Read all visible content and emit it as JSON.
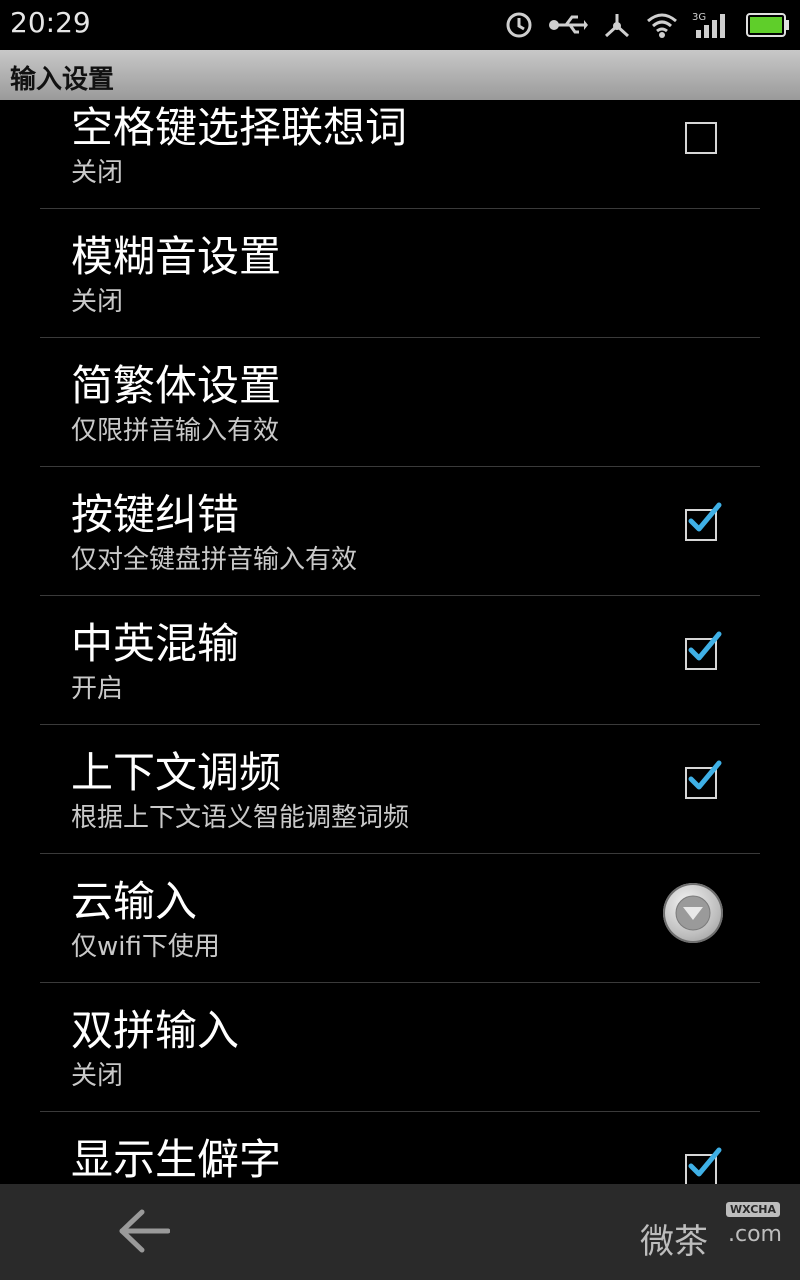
{
  "status_bar": {
    "time": "20:29",
    "icons": [
      "sync-icon",
      "usb-icon",
      "usb-debug-icon",
      "wifi-icon",
      "signal-3g-icon",
      "battery-icon"
    ],
    "network_label": "3G",
    "accent_color": "#5fce2a"
  },
  "title_bar": {
    "title": "输入设置"
  },
  "settings": [
    {
      "title": "空格键选择联想词",
      "summary": "关闭",
      "control": "checkbox",
      "checked": false
    },
    {
      "title": "模糊音设置",
      "summary": "关闭",
      "control": "none"
    },
    {
      "title": "简繁体设置",
      "summary": "仅限拼音输入有效",
      "control": "none"
    },
    {
      "title": "按键纠错",
      "summary": "仅对全键盘拼音输入有效",
      "control": "checkbox",
      "checked": true
    },
    {
      "title": "中英混输",
      "summary": "开启",
      "control": "checkbox",
      "checked": true
    },
    {
      "title": "上下文调频",
      "summary": "根据上下文语义智能调整词频",
      "control": "checkbox",
      "checked": true
    },
    {
      "title": "云输入",
      "summary": "仅wifi下使用",
      "control": "dropdown"
    },
    {
      "title": "双拼输入",
      "summary": "关闭",
      "control": "none"
    },
    {
      "title": "显示生僻字",
      "summary": "",
      "control": "checkbox",
      "checked": true
    }
  ],
  "colors": {
    "check_blue": "#3fb0e6",
    "divider": "#3a3a3a",
    "summary_text": "#c9c9c9"
  },
  "nav_bar": {
    "back_icon": "back-arrow-icon",
    "watermark_main": "微茶",
    "watermark_badge": "WXCHA",
    "watermark_domain": ".com"
  }
}
